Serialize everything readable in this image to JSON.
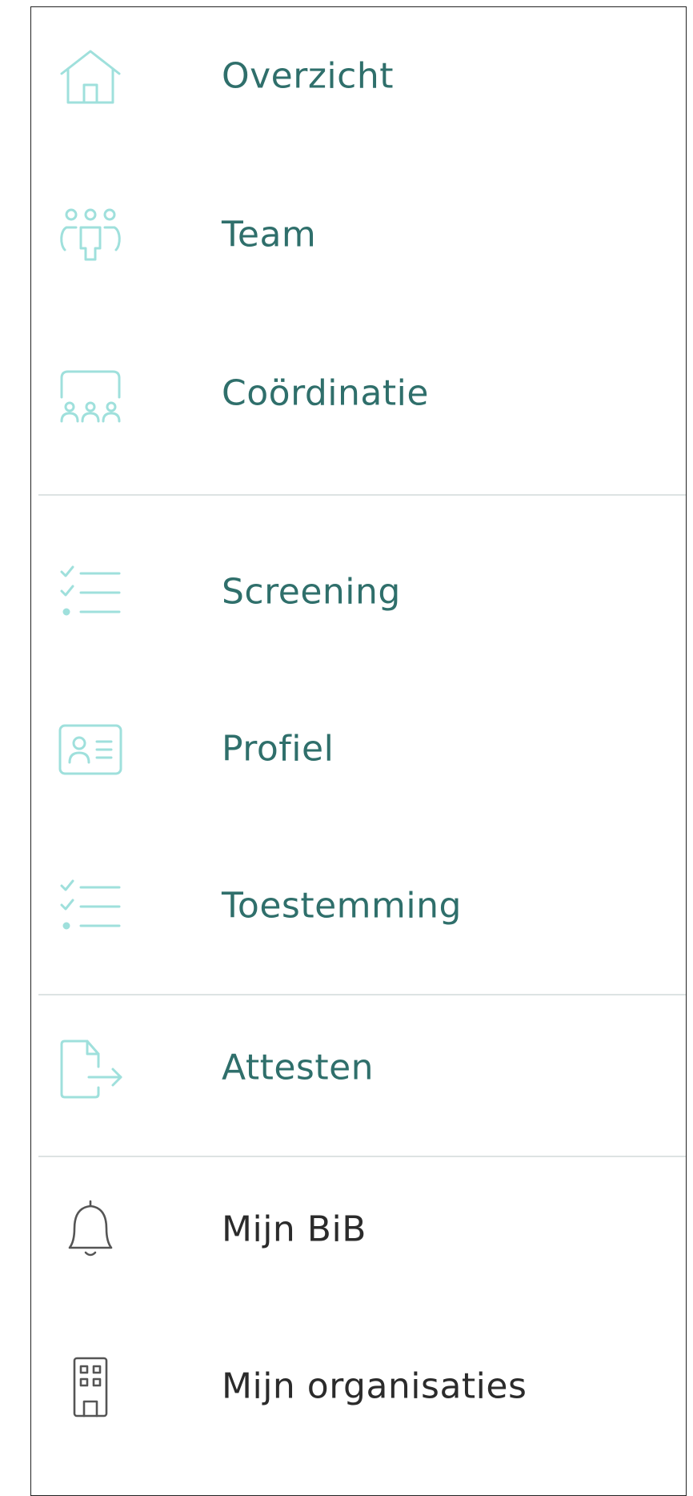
{
  "menu": {
    "items": [
      {
        "label": "Overzicht",
        "icon": "house-icon"
      },
      {
        "label": "Team",
        "icon": "team-icon"
      },
      {
        "label": "Coördinatie",
        "icon": "coordination-icon"
      },
      {
        "label": "Screening",
        "icon": "checklist-icon"
      },
      {
        "label": "Profiel",
        "icon": "id-card-icon"
      },
      {
        "label": "Toestemming",
        "icon": "checklist-icon"
      },
      {
        "label": "Attesten",
        "icon": "document-export-icon"
      },
      {
        "label": "Mijn BiB",
        "icon": "bell-icon"
      },
      {
        "label": "Mijn organisaties",
        "icon": "building-icon"
      }
    ]
  },
  "colors": {
    "accent_icon": "#9fe0dc",
    "accent_text": "#2f6f6b",
    "dark_text": "#2b2b2b",
    "divider": "#dde3e3"
  }
}
